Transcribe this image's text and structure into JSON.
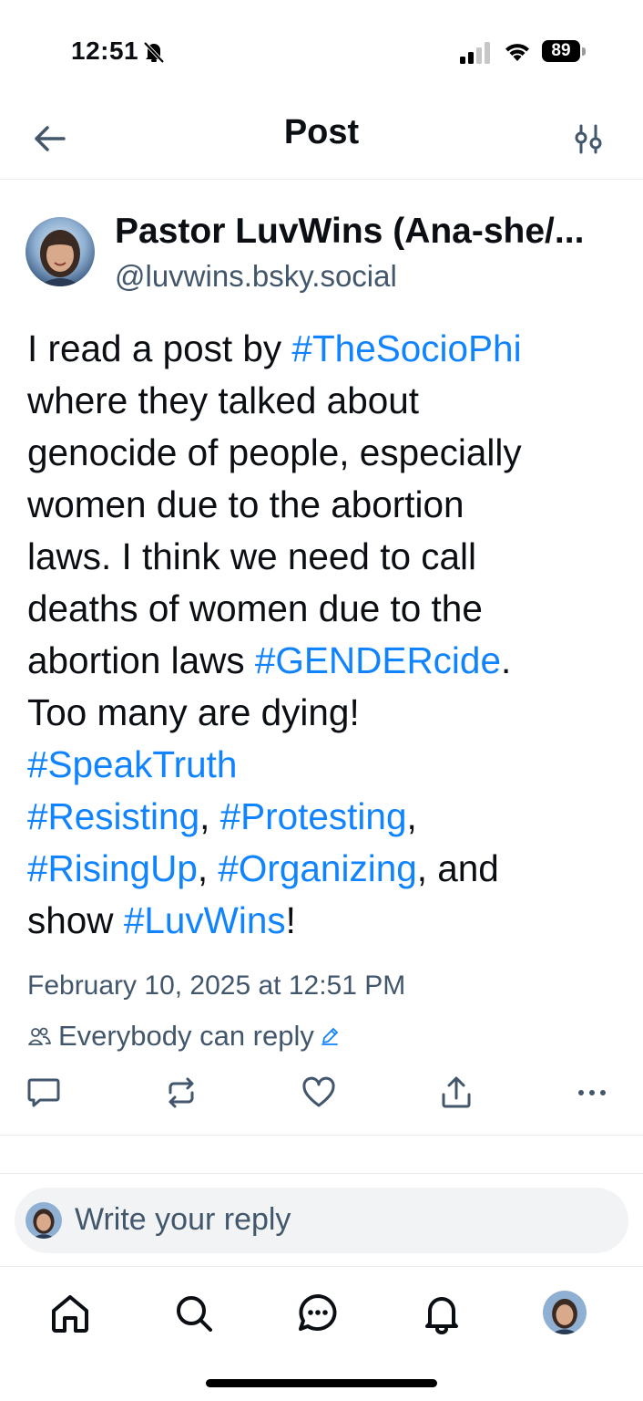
{
  "status_bar": {
    "time": "12:51",
    "battery": "89"
  },
  "header": {
    "title": "Post"
  },
  "post": {
    "author_name": "Pastor LuvWins (Ana-she/...",
    "author_handle": "@luvwins.bsky.social",
    "lines": {
      "l1_text": "I read a post by ",
      "l1_tag": "#TheSocioPhi",
      "l2": "where they talked about",
      "l3": "genocide of people, especially",
      "l4": "women due to the abortion",
      "l5": "laws. I think we need to call",
      "l6": "deaths of women due to the",
      "l7_text": "abortion laws ",
      "l7_tag": "#GENDERcide",
      "l7_end": ".",
      "l8": "Too many are dying!",
      "l9_tag": "#SpeakTruth",
      "l10_tag1": "#Resisting",
      "l10_sep": ", ",
      "l10_tag2": "#Protesting",
      "l10_end": ",",
      "l11_tag1": "#RisingUp",
      "l11_sep": ", ",
      "l11_tag2": "#Organizing",
      "l11_end": ", and",
      "l12_text": "show ",
      "l12_tag": "#LuvWins",
      "l12_end": "!"
    },
    "timestamp": "February 10, 2025 at 12:51 PM",
    "reply_setting": "Everybody can reply"
  },
  "reply_box": {
    "placeholder": "Write your reply"
  },
  "icons": {
    "back": "arrow-left-icon",
    "filter": "sliders-icon",
    "reply": "comment-icon",
    "repost": "repost-icon",
    "like": "heart-icon",
    "share": "share-icon",
    "more": "more-icon",
    "home": "home-icon",
    "search": "search-icon",
    "chat": "chat-icon",
    "notifications": "bell-icon"
  },
  "colors": {
    "link": "#1083fe",
    "muted": "#42576c",
    "text": "#0b0f14"
  }
}
